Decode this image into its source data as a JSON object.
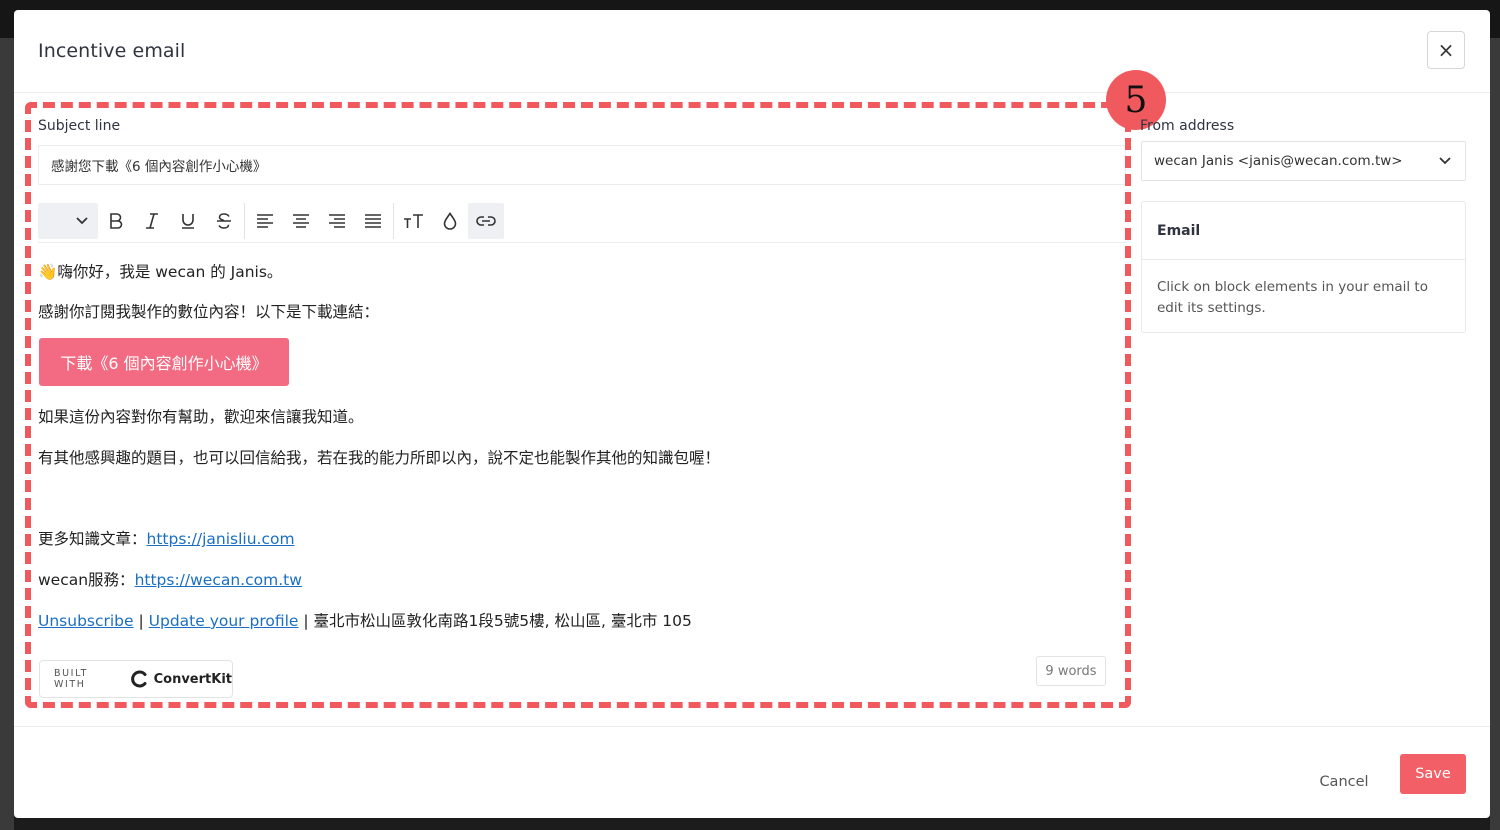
{
  "modal": {
    "title": "Incentive email",
    "close_glyph": "×"
  },
  "subject": {
    "label": "Subject line",
    "value": "感謝您下載《6 個內容創作小心機》"
  },
  "toolbar": {
    "buttons": [
      "chevron-down-icon",
      "bold-icon",
      "italic-icon",
      "underline-icon",
      "strikethrough-icon",
      "align-left-icon",
      "align-center-icon",
      "align-right-icon",
      "align-justify-icon",
      "text-size-icon",
      "color-drop-icon",
      "link-icon"
    ]
  },
  "body": {
    "greeting_emoji": "👋",
    "greeting_text": "嗨你好，我是 wecan 的 Janis。",
    "line_thanks": "感謝你訂閱我製作的數位內容！以下是下載連結：",
    "cta_label": "下載《6 個內容創作小心機》",
    "line_feedback": "如果這份內容對你有幫助，歡迎來信讓我知道。",
    "line_topics": "有其他感興趣的題目，也可以回信給我，若在我的能力所即以內，說不定也能製作其他的知識包喔！",
    "more_articles_label": "更多知識文章：",
    "more_articles_link": "https://janisliu.com",
    "services_label": "wecan服務：",
    "services_link": "https://wecan.com.tw",
    "unsubscribe": "Unsubscribe",
    "separator": " | ",
    "update_profile": "Update your profile",
    "address": "臺北市松山區敦化南路1段5號5樓, 松山區, 臺北市 105"
  },
  "badge": {
    "prefix": "BUILT WITH",
    "brand": "ConvertKit"
  },
  "word_count": "9 words",
  "annotation": {
    "step_number": "5",
    "color": "#f05a5f"
  },
  "sidebar": {
    "from_label": "From address",
    "from_value": "wecan Janis <janis@wecan.com.tw>",
    "email_card_title": "Email",
    "email_card_text": "Click on block elements in your email to edit its settings."
  },
  "footer": {
    "cancel_label": "Cancel",
    "save_label": "Save"
  },
  "colors": {
    "accent": "#f25f66",
    "cta": "#f26b82",
    "link": "#1a6fc4"
  }
}
